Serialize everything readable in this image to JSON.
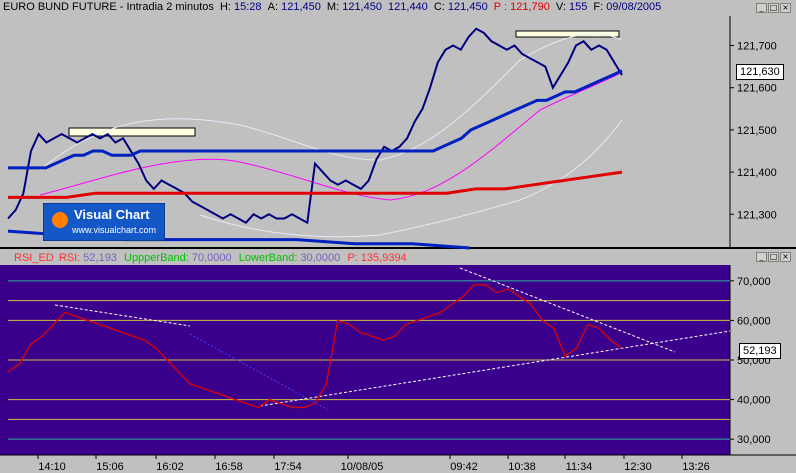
{
  "top": {
    "symbol": "EURO BUND FUTURE - Intradia 2 minutos",
    "h_label": "H:",
    "h_val": "15:28",
    "a_label": "A:",
    "a_val": "121,450",
    "m_label": "M:",
    "m_val": "121,450",
    "l_val": "121,440",
    "c_label": "C:",
    "c_val": "121,450",
    "p_label": "P :",
    "p_val": "121,790",
    "v_label": "V:",
    "v_val": "155",
    "f_label": "F:",
    "f_val": "09/08/2005"
  },
  "bottom": {
    "ind_name": "RSI_ED",
    "rsi_label": "RSI:",
    "rsi_val": "52,193",
    "upper_label": "UppperBand:",
    "upper_val": "70,0000",
    "lower_label": "LowerBand:",
    "lower_val": "30,0000",
    "p_label": "P:",
    "p_val": "135,9394"
  },
  "logo": {
    "title": "Visual Chart",
    "url": "www.visualchart.com"
  },
  "colors": {
    "plot_bg": "#c0c0c0",
    "rsi_bg": "#3a008c",
    "price": "#000080",
    "ma_long": "#e00000",
    "ma_blue": "#0020c0",
    "rsi_line": "#e00000"
  },
  "chart_data": [
    {
      "type": "line",
      "title": "EURO BUND FUTURE - Intradia 2 minutos",
      "yticks": [
        "121,700",
        "121,600",
        "121,500",
        "121,400",
        "121,300"
      ],
      "ylim": [
        121.22,
        121.77
      ],
      "current_value": "121,630",
      "series": [
        {
          "values": [
            121.29,
            121.31,
            121.35,
            121.45,
            121.49,
            121.47,
            121.48,
            121.49,
            121.48,
            121.47,
            121.48,
            121.49,
            121.48,
            121.49,
            121.47,
            121.48,
            121.45,
            121.42,
            121.38,
            121.36,
            121.38,
            121.37,
            121.36,
            121.35,
            121.33,
            121.32,
            121.31,
            121.3,
            121.29,
            121.3,
            121.29,
            121.28,
            121.3,
            121.29,
            121.3,
            121.29,
            121.29,
            121.3,
            121.29,
            121.28,
            121.42,
            121.4,
            121.38,
            121.37,
            121.38,
            121.37,
            121.36,
            121.38,
            121.43,
            121.46,
            121.45,
            121.46,
            121.48,
            121.52,
            121.55,
            121.6,
            121.66,
            121.69,
            121.7,
            121.69,
            121.72,
            121.74,
            121.73,
            121.71,
            121.7,
            121.69,
            121.7,
            121.68,
            121.67,
            121.66,
            121.65,
            121.6,
            121.63,
            121.66,
            121.7,
            121.71,
            121.69,
            121.7,
            121.69,
            121.66,
            121.63
          ]
        },
        {
          "values": [
            121.41,
            121.41,
            121.41,
            121.41,
            121.41,
            121.42,
            121.43,
            121.44,
            121.44,
            121.45,
            121.45,
            121.44,
            121.44,
            121.44,
            121.45,
            121.45,
            121.45,
            121.45,
            121.45,
            121.45,
            121.45,
            121.45,
            121.45,
            121.45,
            121.45,
            121.45,
            121.45,
            121.45,
            121.45,
            121.45,
            121.45,
            121.45,
            121.45,
            121.45,
            121.45,
            121.45,
            121.45,
            121.45,
            121.45,
            121.45,
            121.45,
            121.45,
            121.45,
            121.45,
            121.45,
            121.45,
            121.46,
            121.47,
            121.48,
            121.5,
            121.51,
            121.52,
            121.53,
            121.54,
            121.55,
            121.56,
            121.57,
            121.57,
            121.58,
            121.59,
            121.59,
            121.6,
            121.61,
            121.62,
            121.63,
            121.64
          ]
        },
        {
          "values": [
            121.34,
            121.34,
            121.34,
            121.35,
            121.35,
            121.35,
            121.35,
            121.35,
            121.35,
            121.35,
            121.35,
            121.35,
            121.35,
            121.35,
            121.35,
            121.35,
            121.36,
            121.36,
            121.37,
            121.38,
            121.39,
            121.4
          ]
        },
        {
          "values": [
            121.26,
            121.25,
            121.24,
            121.24,
            121.24,
            121.24,
            121.23,
            121.23,
            121.22
          ]
        }
      ]
    },
    {
      "type": "line",
      "title": "RSI_ED",
      "yticks": [
        "70,000",
        "60,000",
        "50,000",
        "40,000",
        "30,000"
      ],
      "ylim": [
        26,
        74
      ],
      "current_value": "52,193",
      "xticks": [
        "14:10",
        "15:06",
        "16:02",
        "16:58",
        "17:54",
        "10/08/05",
        "09:42",
        "10:38",
        "11:34",
        "12:30",
        "13:26"
      ],
      "series": [
        {
          "values": [
            47,
            49,
            54,
            56,
            59,
            62,
            61,
            60,
            59,
            58,
            57,
            56,
            55,
            53,
            50,
            47,
            44,
            43,
            42,
            41,
            40,
            39,
            38,
            40,
            39,
            38,
            38,
            39,
            44,
            60,
            59,
            57,
            56,
            55,
            56,
            59,
            60,
            61,
            62,
            64,
            66,
            69,
            69,
            67,
            68,
            66,
            64,
            60,
            58,
            51,
            53,
            59,
            58,
            55,
            53
          ]
        }
      ]
    }
  ]
}
